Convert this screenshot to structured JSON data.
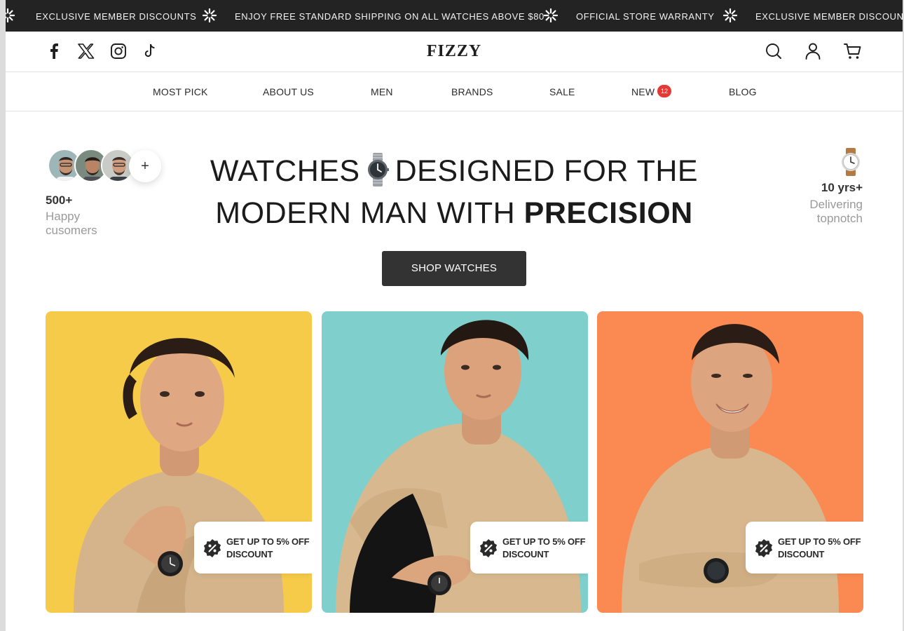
{
  "announcement": {
    "items": [
      "EXCLUSIVE MEMBER DISCOUNTS",
      "ENJOY FREE STANDARD SHIPPING ON ALL WATCHES ABOVE $80",
      "OFFICIAL STORE WARRANTY",
      "EXCLUSIVE MEMBER DISCOUNTS"
    ],
    "separator_icon": "sparkle-icon"
  },
  "header": {
    "logo": "FIZZY",
    "social_icons": [
      "facebook-icon",
      "x-icon",
      "instagram-icon",
      "tiktok-icon"
    ],
    "action_icons": [
      "search-icon",
      "user-icon",
      "cart-icon"
    ]
  },
  "nav": {
    "items": [
      "MOST PICK",
      "ABOUT US",
      "MEN",
      "BRANDS",
      "SALE",
      "NEW",
      "BLOG"
    ],
    "new_badge": "12"
  },
  "hero": {
    "headline_line1_a": "WATCHES",
    "headline_line1_b": "DESIGNED FOR THE",
    "headline_line2_a": "MODERN MAN WITH",
    "headline_line2_b": "PRECISION",
    "customers_count": "500+",
    "customers_label_1": "Happy",
    "customers_label_2": "cusomers",
    "avatar_more": "+",
    "years_count": "10 yrs+",
    "years_label_1": "Delivering",
    "years_label_2": "topnotch",
    "cta_label": "SHOP WATCHES"
  },
  "cards": [
    {
      "bg": "#f6cb4a",
      "promo_line1": "GET UP TO 5% OFF",
      "promo_line2": "DISCOUNT"
    },
    {
      "bg": "#7fd0cc",
      "promo_line1": "GET UP TO 5% OFF",
      "promo_line2": "DISCOUNT"
    },
    {
      "bg": "#fb8a52",
      "promo_line1": "GET UP TO 5% OFF",
      "promo_line2": "DISCOUNT"
    }
  ],
  "colors": {
    "announcement_bg": "#232323",
    "cta_bg": "#333333",
    "badge": "#e53935"
  }
}
